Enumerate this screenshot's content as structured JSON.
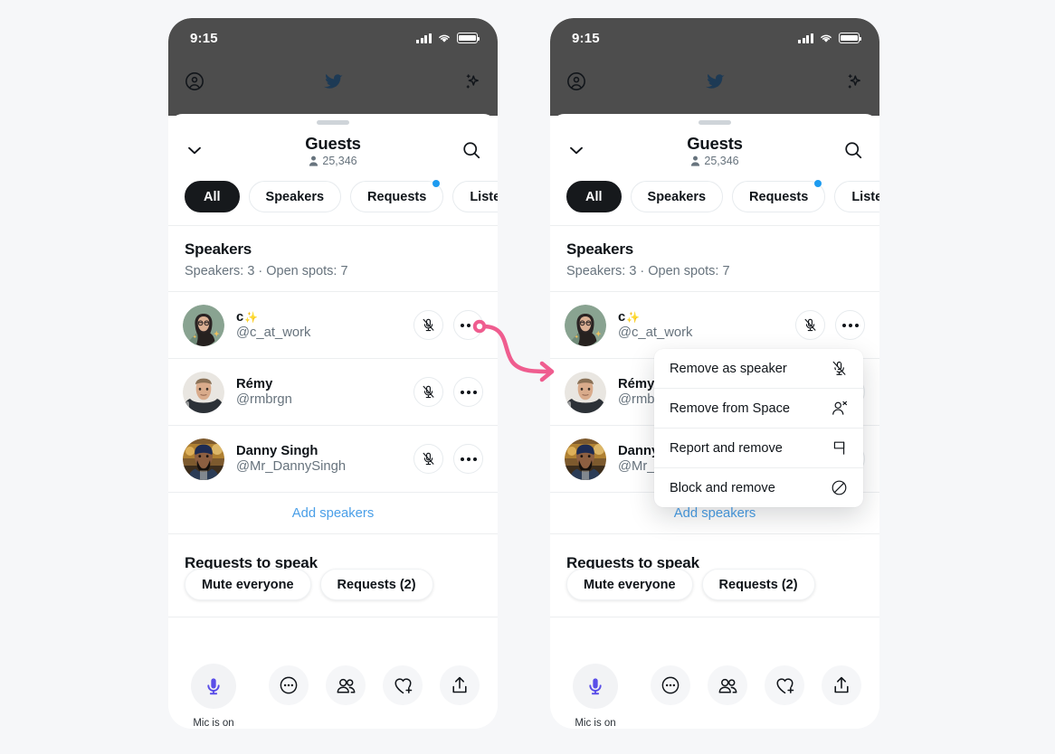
{
  "accent": {
    "pink": "#ef5d8f",
    "blue": "#1d9bf0",
    "link": "#4a9fe8",
    "mic_purple": "#5a4ee8",
    "twitter_navy": "#1d3a55",
    "dark_chip": "#16191c",
    "chrome_gray": "#4d4d4d",
    "page_bg": "#f6f7f9"
  },
  "status_bar": {
    "time": "9:15",
    "signal_icon": "cellular-bars-icon",
    "wifi_icon": "wifi-icon",
    "battery_icon": "battery-full-icon"
  },
  "app_nav": {
    "profile_icon": "account-circle-icon",
    "logo_icon": "twitter-bird-icon",
    "sparkle_icon": "sparkles-icon"
  },
  "sheet": {
    "grabber_icon": "drag-handle-icon",
    "collapse_icon": "chevron-down-icon",
    "title": "Guests",
    "count_icon": "person-icon",
    "count": "25,346",
    "search_icon": "search-icon",
    "tabs": [
      {
        "label": "All",
        "active": true,
        "badge": false
      },
      {
        "label": "Speakers",
        "active": false,
        "badge": false
      },
      {
        "label": "Requests",
        "active": false,
        "badge": true
      },
      {
        "label": "Listening",
        "active": false,
        "badge": false
      }
    ]
  },
  "speakers_section": {
    "heading": "Speakers",
    "subtext": "Speakers: 3 · Open spots: 7",
    "rows": [
      {
        "name": "c",
        "name_emoji": "✨",
        "handle": "@c_at_work",
        "avatar": "avatar-c-at-work",
        "mic_icon": "mic-off-icon",
        "more_icon": "more-horizontal-icon"
      },
      {
        "name": "Rémy",
        "name_emoji": "",
        "handle": "@rmbrgn",
        "avatar": "avatar-remy",
        "mic_icon": "mic-off-icon",
        "more_icon": "more-horizontal-icon"
      },
      {
        "name": "Danny Singh",
        "name_emoji": "",
        "handle": "@Mr_DannySingh",
        "avatar": "avatar-danny-singh",
        "mic_icon": "mic-off-icon",
        "more_icon": "more-horizontal-icon"
      }
    ],
    "add_speakers_label": "Add speakers"
  },
  "requests_section": {
    "heading": "Requests to speak",
    "chips": [
      {
        "label": "Mute everyone"
      },
      {
        "label": "Requests (2)"
      }
    ]
  },
  "bottom_bar": {
    "mic_icon": "mic-on-icon",
    "mic_label": "Mic is on",
    "tools": [
      {
        "icon": "more-circle-icon",
        "name": "more-options-button"
      },
      {
        "icon": "people-icon",
        "name": "guests-button"
      },
      {
        "icon": "heart-plus-icon",
        "name": "react-button"
      },
      {
        "icon": "share-up-icon",
        "name": "share-button"
      }
    ]
  },
  "context_menu": {
    "items": [
      {
        "label": "Remove as speaker",
        "icon": "mic-off-slash-icon"
      },
      {
        "label": "Remove from Space",
        "icon": "person-remove-icon"
      },
      {
        "label": "Report and remove",
        "icon": "flag-icon"
      },
      {
        "label": "Block and remove",
        "icon": "block-icon"
      }
    ]
  },
  "connector": {
    "icon": "curved-arrow-icon",
    "description": "pink arrow from more-options button to context menu"
  }
}
